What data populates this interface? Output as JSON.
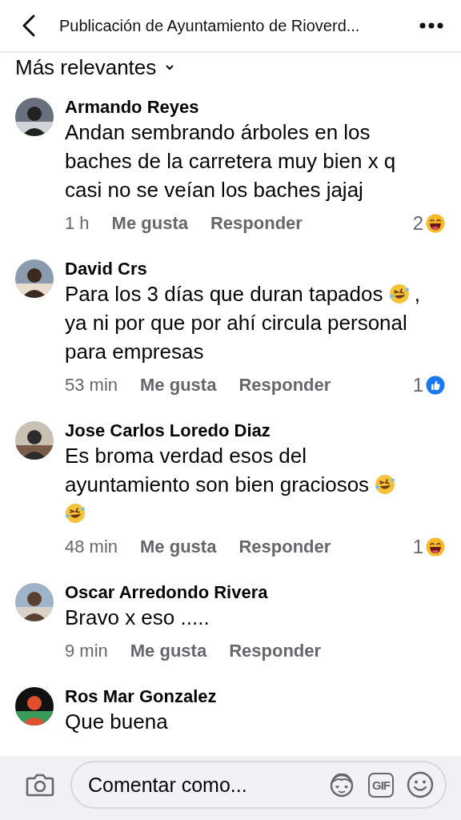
{
  "header": {
    "title": "Publicación de Ayuntamiento de Rioverd..."
  },
  "sort": {
    "label": "Más relevantes"
  },
  "comments": [
    {
      "author": "Armando Reyes",
      "body": [
        {
          "kind": "text",
          "text": "Andan sembrando árboles en los baches de la carretera muy bien x q casi no se veían los baches jajaj"
        }
      ],
      "time": "1 h",
      "like": "Me gusta",
      "reply": "Responder",
      "reaction": {
        "kind": "haha",
        "count": "2"
      }
    },
    {
      "author": "David Crs",
      "body": [
        {
          "kind": "text",
          "text": "Para los 3 días que duran tapados "
        },
        {
          "kind": "emoji"
        },
        {
          "kind": "text",
          "text": ", ya ni por que por ahí circula personal para empresas"
        }
      ],
      "time": "53 min",
      "like": "Me gusta",
      "reply": "Responder",
      "reaction": {
        "kind": "like",
        "count": "1"
      }
    },
    {
      "author": "Jose Carlos Loredo Diaz",
      "body": [
        {
          "kind": "text",
          "text": "Es broma verdad esos del ayuntamiento son bien graciosos "
        },
        {
          "kind": "emoji"
        },
        {
          "kind": "emoji"
        }
      ],
      "time": "48 min",
      "like": "Me gusta",
      "reply": "Responder",
      "reaction": {
        "kind": "haha",
        "count": "1"
      }
    },
    {
      "author": "Oscar Arredondo Rivera",
      "body": [
        {
          "kind": "text",
          "text": "Bravo x eso ....."
        }
      ],
      "time": "9 min",
      "like": "Me gusta",
      "reply": "Responder"
    },
    {
      "author": "Ros Mar Gonzalez",
      "body": [
        {
          "kind": "text",
          "text": "Que buena"
        }
      ]
    }
  ],
  "composer": {
    "placeholder": "Comentar como...",
    "gif": "GIF"
  }
}
